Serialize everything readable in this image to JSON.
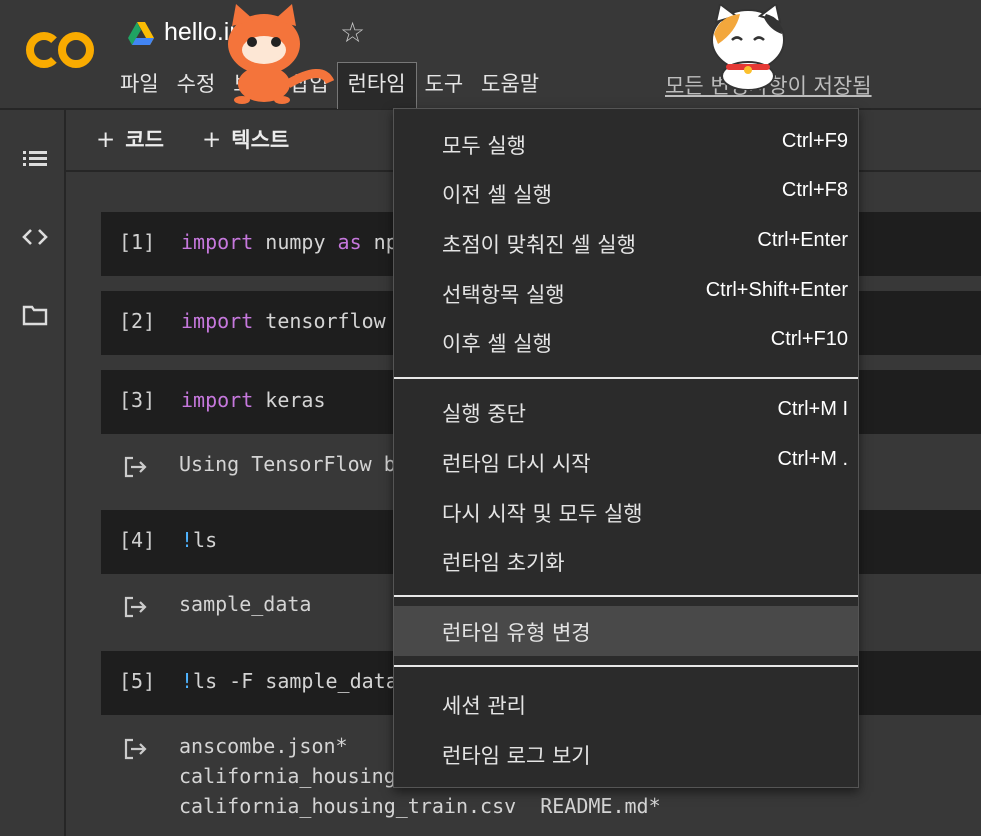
{
  "header": {
    "logo_text": "CO",
    "title": "hello.ipynb",
    "star_icon": "star-outline-icon",
    "saved_status": "모든 변경사항이 저장됨"
  },
  "menubar": [
    "파일",
    "수정",
    "보기",
    "삽입",
    "런타임",
    "도구",
    "도움말"
  ],
  "sidebar": {
    "icons": [
      "table-of-contents-icon",
      "code-snippets-icon",
      "folder-icon"
    ]
  },
  "toolbar": {
    "add_code": "코드",
    "add_text": "텍스트"
  },
  "cells": [
    {
      "num": "[1]",
      "kw": "import",
      "rest": " numpy ",
      "kw2": "as",
      "rest2": " np"
    },
    {
      "num": "[2]",
      "kw": "import",
      "rest": " tensorflow "
    },
    {
      "num": "[3]",
      "kw": "import",
      "rest": " keras"
    },
    {
      "num": "[4]",
      "bang": "!",
      "rest": "ls"
    },
    {
      "num": "[5]",
      "bang": "!",
      "rest": "ls -F sample_data"
    }
  ],
  "outputs": [
    {
      "text": "Using TensorFlow b"
    },
    {
      "text": "sample_data"
    },
    {
      "text": "anscombe.json*\ncalifornia_housing\ncalifornia_housing_train.csv  README.md*"
    }
  ],
  "runtime_menu": {
    "groups": [
      [
        {
          "label": "모두 실행",
          "shortcut": "Ctrl+F9"
        },
        {
          "label": "이전 셀 실행",
          "shortcut": "Ctrl+F8"
        },
        {
          "label": "초점이 맞춰진 셀 실행",
          "shortcut": "Ctrl+Enter"
        },
        {
          "label": "선택항목 실행",
          "shortcut": "Ctrl+Shift+Enter"
        },
        {
          "label": "이후 셀 실행",
          "shortcut": "Ctrl+F10"
        }
      ],
      [
        {
          "label": "실행 중단",
          "shortcut": "Ctrl+M I"
        },
        {
          "label": "런타임 다시 시작",
          "shortcut": "Ctrl+M ."
        },
        {
          "label": "다시 시작 및 모두 실행",
          "shortcut": ""
        },
        {
          "label": "런타임 초기화",
          "shortcut": ""
        }
      ],
      [
        {
          "label": "런타임 유형 변경",
          "shortcut": "",
          "highlighted": true
        }
      ],
      [
        {
          "label": "세션 관리",
          "shortcut": ""
        },
        {
          "label": "런타임 로그 보기",
          "shortcut": ""
        }
      ]
    ]
  },
  "colors": {
    "background": "#383838",
    "cell_bg": "#1e1e1e",
    "keyword": "#c678dd",
    "bang": "#4fb4ff",
    "logo_orange": "#f9ab00",
    "menu_bg": "#2b2b2b"
  }
}
